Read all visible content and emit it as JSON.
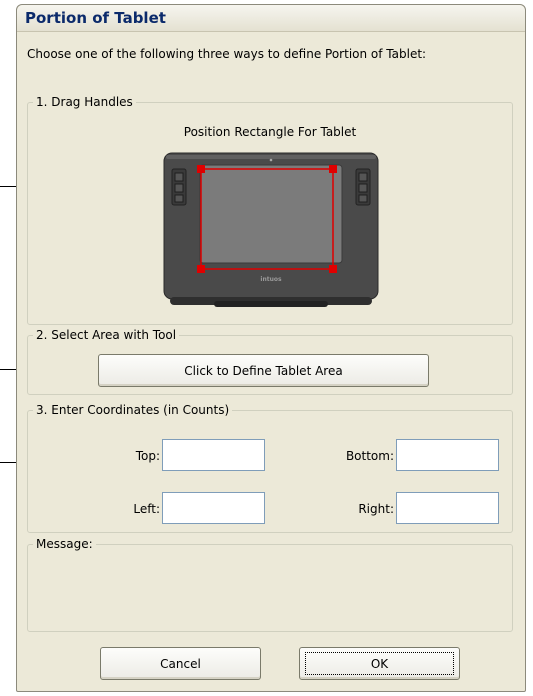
{
  "window": {
    "title": "Portion of Tablet"
  },
  "intro_text": "Choose one of the following three ways to define Portion of Tablet:",
  "section1": {
    "legend": "1. Drag Handles",
    "caption": "Position Rectangle For Tablet",
    "brand_text": "intuos"
  },
  "section2": {
    "legend": "2. Select Area with Tool",
    "button_label": "Click to Define Tablet Area"
  },
  "section3": {
    "legend": "3. Enter Coordinates (in Counts)",
    "top_label": "Top:",
    "bottom_label": "Bottom:",
    "left_label": "Left:",
    "right_label": "Right:",
    "top_value": "",
    "bottom_value": "",
    "left_value": "",
    "right_value": ""
  },
  "message": {
    "legend": "Message:",
    "text": ""
  },
  "buttons": {
    "cancel": "Cancel",
    "ok": "OK"
  },
  "colors": {
    "selection": "#e00000",
    "tablet_body": "#4a4a4a",
    "tablet_surface": "#7b7b7b"
  }
}
